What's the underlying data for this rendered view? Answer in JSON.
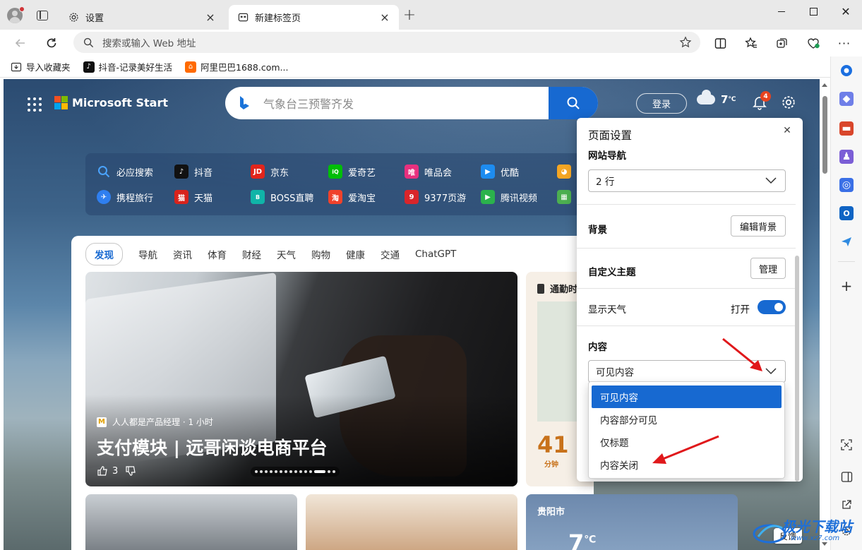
{
  "browser": {
    "tabs": [
      {
        "title": "设置",
        "icon": "gear-icon",
        "active": false
      },
      {
        "title": "新建标签页",
        "icon": "newtab-icon",
        "active": true
      }
    ],
    "address_placeholder": "搜索或输入 Web 地址",
    "favorites": [
      {
        "label": "导入收藏夹",
        "icon": "import-favorites-icon"
      },
      {
        "label": "抖音-记录美好生活",
        "icon": "douyin-icon"
      },
      {
        "label": "阿里巴巴1688.com...",
        "icon": "alibaba-icon"
      }
    ]
  },
  "newtab": {
    "brand": "Microsoft Start",
    "search_text": "气象台三预警齐发",
    "login_label": "登录",
    "temperature": "7",
    "temp_unit": "℃",
    "notification_count": "4",
    "quick_links": [
      {
        "label": "必应搜索",
        "color": "#2b6ed1",
        "glyph": "Q"
      },
      {
        "label": "抖音",
        "color": "#111111",
        "glyph": "♪"
      },
      {
        "label": "京东",
        "color": "#e1251b",
        "glyph": "JD"
      },
      {
        "label": "爱奇艺",
        "color": "#00be06",
        "glyph": "iQ"
      },
      {
        "label": "唯品会",
        "color": "#e7307e",
        "glyph": "唯"
      },
      {
        "label": "优酷",
        "color": "#1d8cf0",
        "glyph": "▶"
      },
      {
        "label": "携程旅行",
        "color": "#2f7ff0",
        "glyph": "✈"
      },
      {
        "label": "天猫",
        "color": "#d8231c",
        "glyph": "猫"
      },
      {
        "label": "BOSS直聘",
        "color": "#10b4a8",
        "glyph": "B"
      },
      {
        "label": "爱淘宝",
        "color": "#f0422b",
        "glyph": "淘"
      },
      {
        "label": "9377页游",
        "color": "#d9252a",
        "glyph": "9"
      },
      {
        "label": "腾讯视频",
        "color": "#2bb24c",
        "glyph": "▶"
      }
    ],
    "feed_tabs": [
      "发现",
      "导航",
      "资讯",
      "体育",
      "财经",
      "天气",
      "购物",
      "健康",
      "交通",
      "ChatGPT"
    ],
    "hero": {
      "source": "人人都是产品经理 · 1 小时",
      "title": "支付模块 | 远哥闲谈电商平台",
      "likes": "3"
    },
    "side_card": {
      "header": "通勤时",
      "number": "41",
      "unit": "分钟"
    },
    "weather_card": {
      "city": "贵阳市",
      "temp": "7",
      "unit": "℃"
    },
    "feedback_label": "反馈"
  },
  "settings_panel": {
    "title": "页面设置",
    "site_nav_label": "网站导航",
    "site_nav_value": "2 行",
    "background_label": "背景",
    "edit_background_label": "编辑背景",
    "custom_theme_label": "自定义主题",
    "manage_label": "管理",
    "show_weather_label": "显示天气",
    "toggle_state_label": "打开",
    "content_label": "内容",
    "content_value": "可见内容",
    "content_options": [
      "可见内容",
      "内容部分可见",
      "仅标题",
      "内容关闭"
    ]
  },
  "watermark": {
    "text": "极光下载站",
    "sub": "www.xz7.com"
  }
}
